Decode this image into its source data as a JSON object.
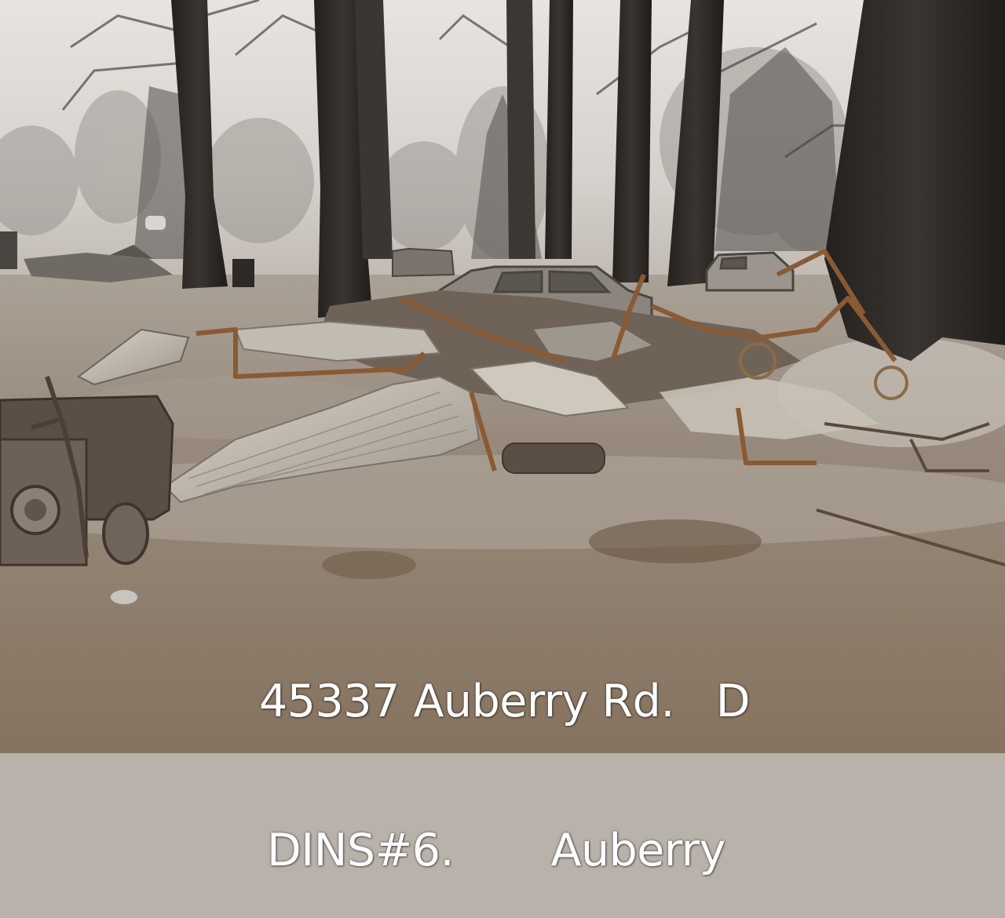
{
  "caption": {
    "line1": "45337 Auberry Rd.   D",
    "line2": "DINS#6.       Auberry"
  },
  "colors": {
    "sky": "#e4e0dc",
    "ground": "#8f7f70",
    "ash": "#c9c3bb",
    "trunk": "#2f2b28",
    "rust": "#8a5a34",
    "caption_text": "#ffffff"
  }
}
